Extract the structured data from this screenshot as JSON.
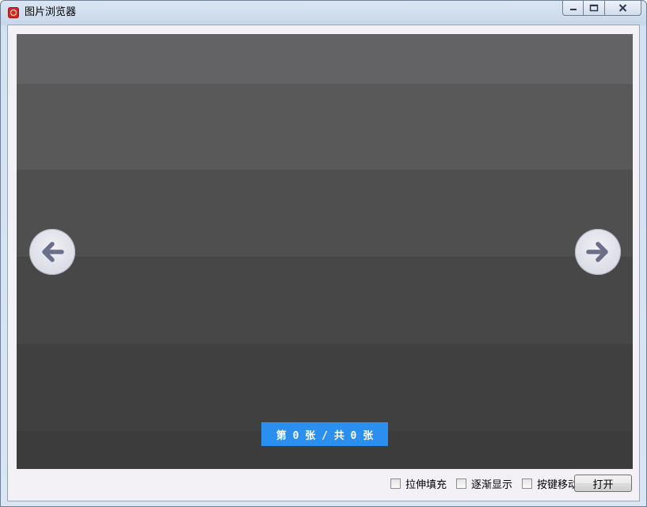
{
  "window": {
    "title": "图片浏览器",
    "app_icon": "app-icon"
  },
  "title_controls": {
    "minimize": "—",
    "maximize": "▭",
    "close": "✕"
  },
  "viewer": {
    "prev_icon": "arrow-left-icon",
    "next_icon": "arrow-right-icon",
    "counter": "第 0 张 / 共 0 张",
    "accent_color": "#2b8ff0"
  },
  "options": [
    {
      "label": "拉伸填充",
      "checked": false
    },
    {
      "label": "逐渐显示",
      "checked": false
    },
    {
      "label": "按键移动",
      "checked": false
    }
  ],
  "open_button": {
    "label": "打开"
  }
}
